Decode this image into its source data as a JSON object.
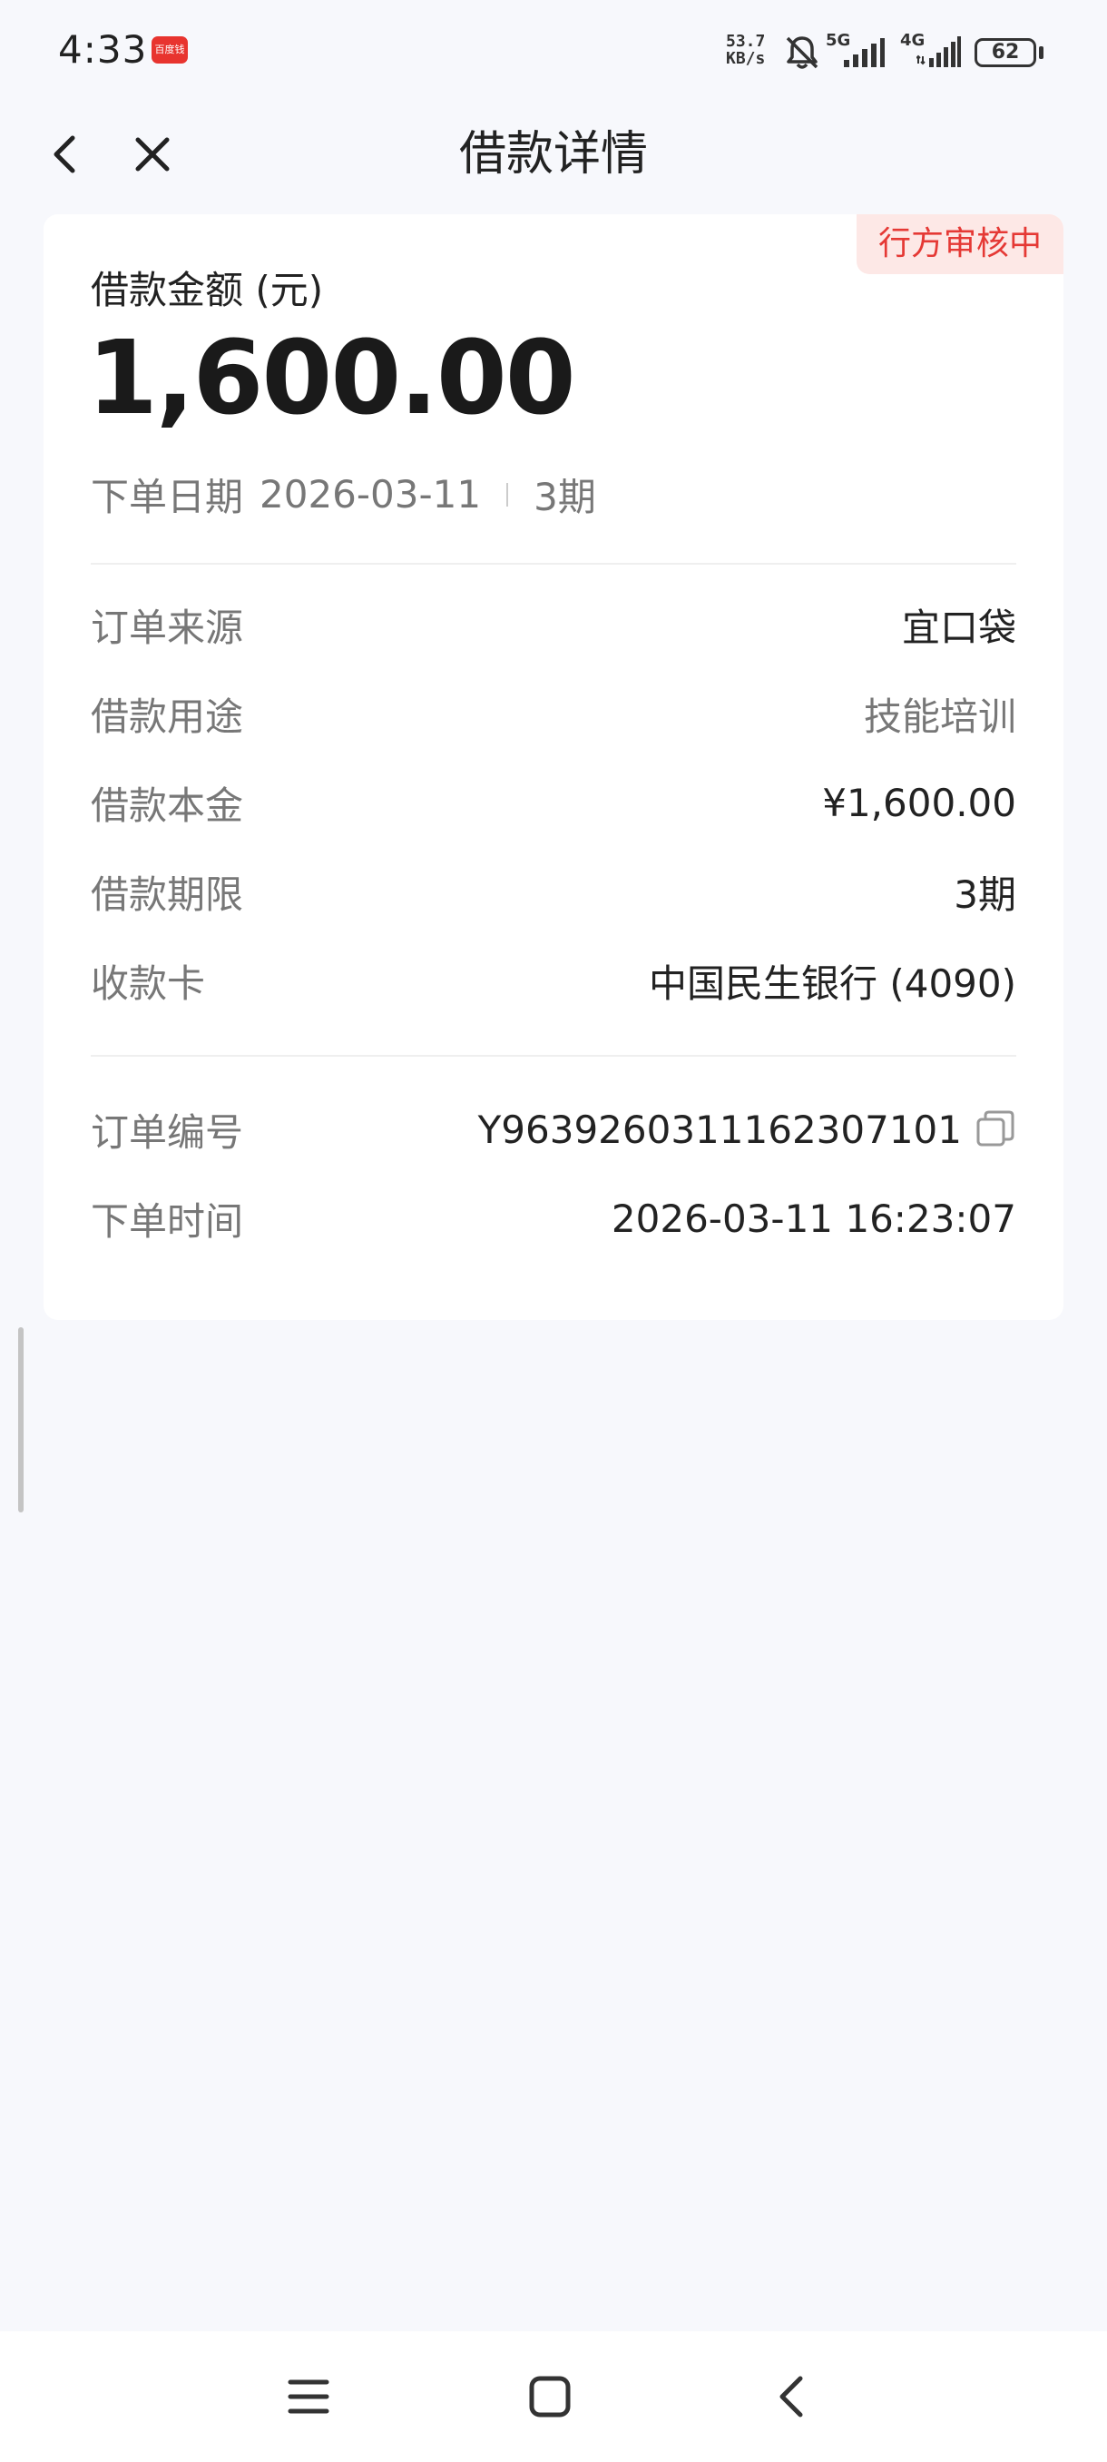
{
  "status_bar": {
    "time": "4:33",
    "notification_app": "百度钱包",
    "network_speed_value": "53.7",
    "network_speed_unit": "KB/s",
    "signal_1_label": "5G",
    "signal_2_label": "4G",
    "battery": "62"
  },
  "header": {
    "title": "借款详情"
  },
  "loan": {
    "status": "行方审核中",
    "amount_label": "借款金额 (元)",
    "amount": "1,600.00",
    "order_date_label": "下单日期",
    "order_date": "2026-03-11",
    "term_short": "3期",
    "details": [
      {
        "label": "订单来源",
        "value": "宜口袋"
      },
      {
        "label": "借款用途",
        "value": "技能培训"
      },
      {
        "label": "借款本金",
        "value": "¥1,600.00"
      },
      {
        "label": "借款期限",
        "value": "3期"
      },
      {
        "label": "收款卡",
        "value": "中国民生银行 (4090)"
      }
    ],
    "order_no_label": "订单编号",
    "order_no": "Y9639260311162307101",
    "order_time_label": "下单时间",
    "order_time": "2026-03-11 16:23:07"
  }
}
